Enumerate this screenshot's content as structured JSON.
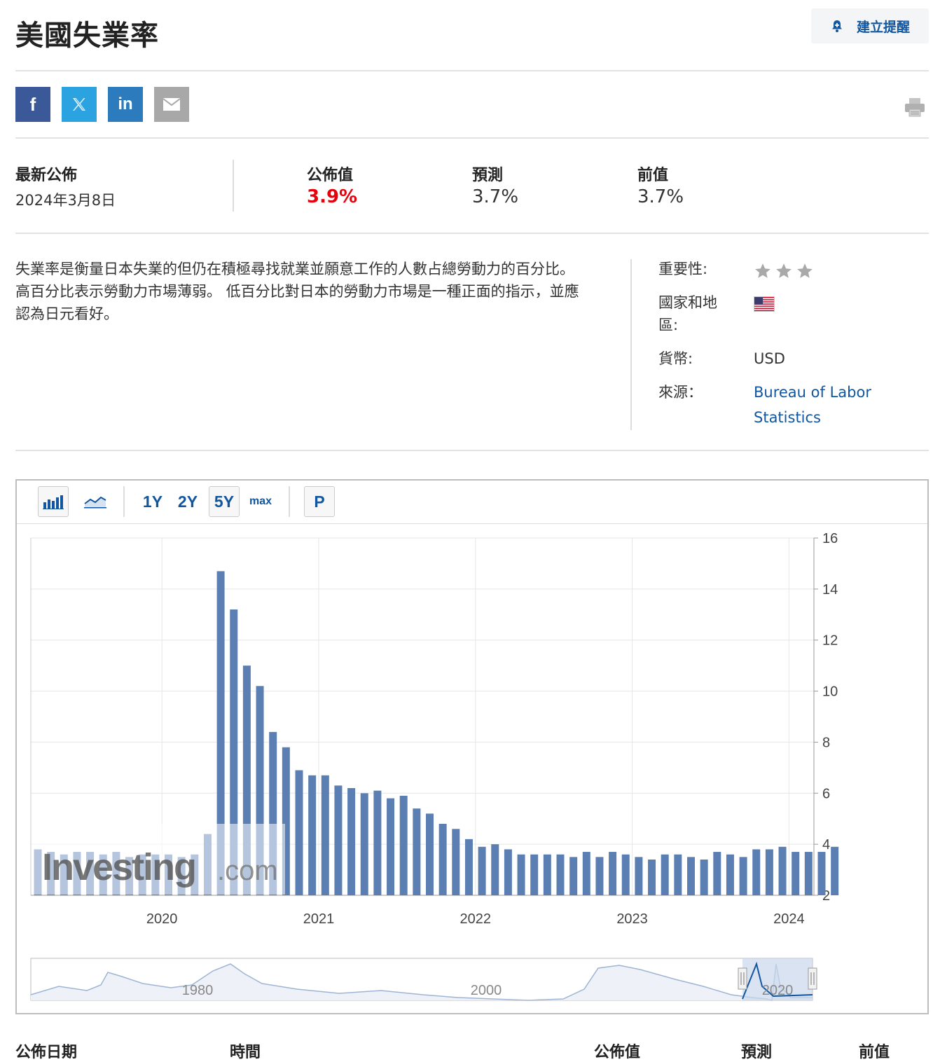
{
  "header": {
    "title": "美國失業率",
    "alert_label": "建立提醒"
  },
  "share": {
    "facebook": "f",
    "twitter": "𝕏",
    "linkedin": "in"
  },
  "release": {
    "latest_label": "最新公佈",
    "latest_date": "2024年3月8日",
    "actual_label": "公佈值",
    "actual_value": "3.9%",
    "forecast_label": "預測",
    "forecast_value": "3.7%",
    "previous_label": "前值",
    "previous_value": "3.7%"
  },
  "description": "失業率是衡量日本失業的但仍在積極尋找就業並願意工作的人數占總勞動力的百分比。 高百分比表示勞動力市場薄弱。 低百分比對日本的勞動力市場是一種正面的指示，並應認為日元看好。",
  "meta": {
    "importance_label": "重要性:",
    "importance_stars": 3,
    "country_label_1": "國家和地",
    "country_label_2": "區:",
    "currency_label": "貨幣:",
    "currency_value": "USD",
    "source_label": "來源：",
    "source_value_1": "Bureau of Labor",
    "source_value_2": "Statistics"
  },
  "toolbar": {
    "range_1y": "1Y",
    "range_2y": "2Y",
    "range_5y": "5Y",
    "range_max": "max",
    "p_label": "P"
  },
  "chart_data": {
    "type": "bar",
    "y_ticks": [
      "2",
      "4",
      "6",
      "8",
      "10",
      "12",
      "14",
      "16"
    ],
    "ylim": [
      2,
      16
    ],
    "x_ticks": [
      "2020",
      "2021",
      "2022",
      "2023",
      "2024"
    ],
    "start": "2019-03",
    "values": [
      3.8,
      3.7,
      3.6,
      3.7,
      3.7,
      3.6,
      3.7,
      3.5,
      3.6,
      3.6,
      3.6,
      3.5,
      3.6,
      4.4,
      14.7,
      13.2,
      11.0,
      10.2,
      8.4,
      7.8,
      6.9,
      6.7,
      6.7,
      6.3,
      6.2,
      6.0,
      6.1,
      5.8,
      5.9,
      5.4,
      5.2,
      4.8,
      4.6,
      4.2,
      3.9,
      4.0,
      3.8,
      3.6,
      3.6,
      3.6,
      3.6,
      3.5,
      3.7,
      3.5,
      3.7,
      3.6,
      3.5,
      3.4,
      3.6,
      3.6,
      3.5,
      3.4,
      3.7,
      3.6,
      3.5,
      3.8,
      3.8,
      3.9,
      3.7,
      3.7,
      3.7,
      3.9
    ],
    "watermark": "Investing",
    "watermark_suffix": ".com",
    "navigator_ticks": [
      "1980",
      "2000",
      "2020"
    ]
  },
  "table_header": {
    "release_date": "公佈日期",
    "time": "時間",
    "actual": "公佈值",
    "forecast": "預測",
    "previous": "前值"
  }
}
